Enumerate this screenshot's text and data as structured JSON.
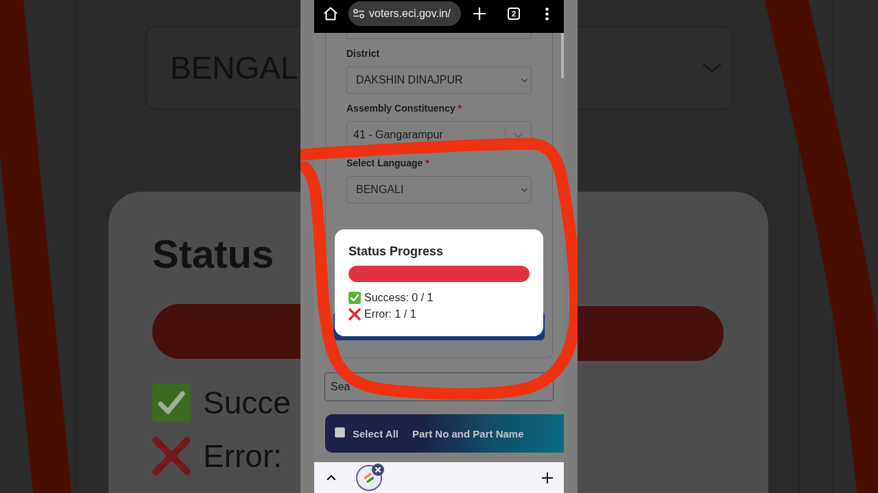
{
  "backdrop": {
    "language_select": {
      "value": "BENGAL"
    },
    "dialog": {
      "title": "Status",
      "progress": {
        "level": 1
      },
      "lines": [
        {
          "kind": "success",
          "text": "Succe"
        },
        {
          "kind": "error",
          "text": "Error:"
        }
      ]
    }
  },
  "browser": {
    "url": "voters.eci.gov.in/",
    "tab_count": "2"
  },
  "form": {
    "fields": [
      {
        "kind": "select",
        "label": "District",
        "value": "DAKSHIN DINAJPUR"
      },
      {
        "kind": "combo",
        "label": "Assembly Constituency",
        "required_mark": "*",
        "value": "41 - Gangarampur"
      },
      {
        "kind": "select",
        "label": "Select Language",
        "required_mark": "*",
        "value": "BENGALI"
      }
    ]
  },
  "search": {
    "placeholder": "Sea"
  },
  "table": {
    "columns": [
      {
        "kind": "checkbox",
        "label": "Select All",
        "checked": false
      },
      {
        "kind": "text",
        "label": "Part No and Part Name"
      }
    ]
  },
  "dialog": {
    "title": "Status Progress",
    "progress": {
      "level": 1
    },
    "lines": [
      {
        "kind": "success",
        "text": "Success: 0 / 1"
      },
      {
        "kind": "error",
        "text": "Error: 1 / 1"
      }
    ]
  }
}
